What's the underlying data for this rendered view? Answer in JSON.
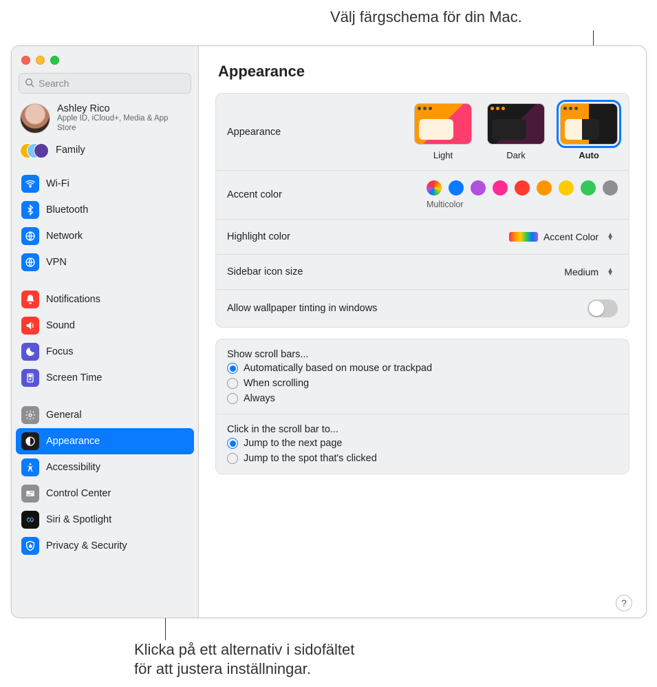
{
  "callouts": {
    "top": "Välj färgschema för din Mac.",
    "bottom_l1": "Klicka på ett alternativ i sidofältet",
    "bottom_l2": "för att justera inställningar."
  },
  "search": {
    "placeholder": "Search"
  },
  "user": {
    "name": "Ashley Rico",
    "subtitle": "Apple ID, iCloud+, Media & App Store"
  },
  "family": {
    "label": "Family"
  },
  "sidebar": {
    "g1": [
      {
        "label": "Wi-Fi",
        "key": "wifi",
        "color": "bg-blue"
      },
      {
        "label": "Bluetooth",
        "key": "bluetooth",
        "color": "bg-blue"
      },
      {
        "label": "Network",
        "key": "network",
        "color": "bg-blue"
      },
      {
        "label": "VPN",
        "key": "vpn",
        "color": "bg-blue"
      }
    ],
    "g2": [
      {
        "label": "Notifications",
        "key": "notifications",
        "color": "bg-red"
      },
      {
        "label": "Sound",
        "key": "sound",
        "color": "bg-red"
      },
      {
        "label": "Focus",
        "key": "focus",
        "color": "bg-indigo"
      },
      {
        "label": "Screen Time",
        "key": "screen-time",
        "color": "bg-indigo"
      }
    ],
    "g3": [
      {
        "label": "General",
        "key": "general",
        "color": "bg-grey"
      },
      {
        "label": "Appearance",
        "key": "appearance",
        "color": "bg-black",
        "selected": true
      },
      {
        "label": "Accessibility",
        "key": "accessibility",
        "color": "bg-blue"
      },
      {
        "label": "Control Center",
        "key": "control-center",
        "color": "bg-grey"
      },
      {
        "label": "Siri & Spotlight",
        "key": "siri",
        "color": "bg-siri"
      },
      {
        "label": "Privacy & Security",
        "key": "privacy",
        "color": "bg-blue"
      }
    ]
  },
  "main": {
    "title": "Appearance",
    "appearance_label": "Appearance",
    "modes": {
      "light": "Light",
      "dark": "Dark",
      "auto": "Auto"
    },
    "accent_label": "Accent color",
    "accent_sub": "Multicolor",
    "highlight_label": "Highlight color",
    "highlight_value": "Accent Color",
    "sidebar_size_label": "Sidebar icon size",
    "sidebar_size_value": "Medium",
    "tint_label": "Allow wallpaper tinting in windows",
    "scroll_title": "Show scroll bars...",
    "scroll_opts": [
      "Automatically based on mouse or trackpad",
      "When scrolling",
      "Always"
    ],
    "click_title": "Click in the scroll bar to...",
    "click_opts": [
      "Jump to the next page",
      "Jump to the spot that's clicked"
    ],
    "help": "?"
  }
}
